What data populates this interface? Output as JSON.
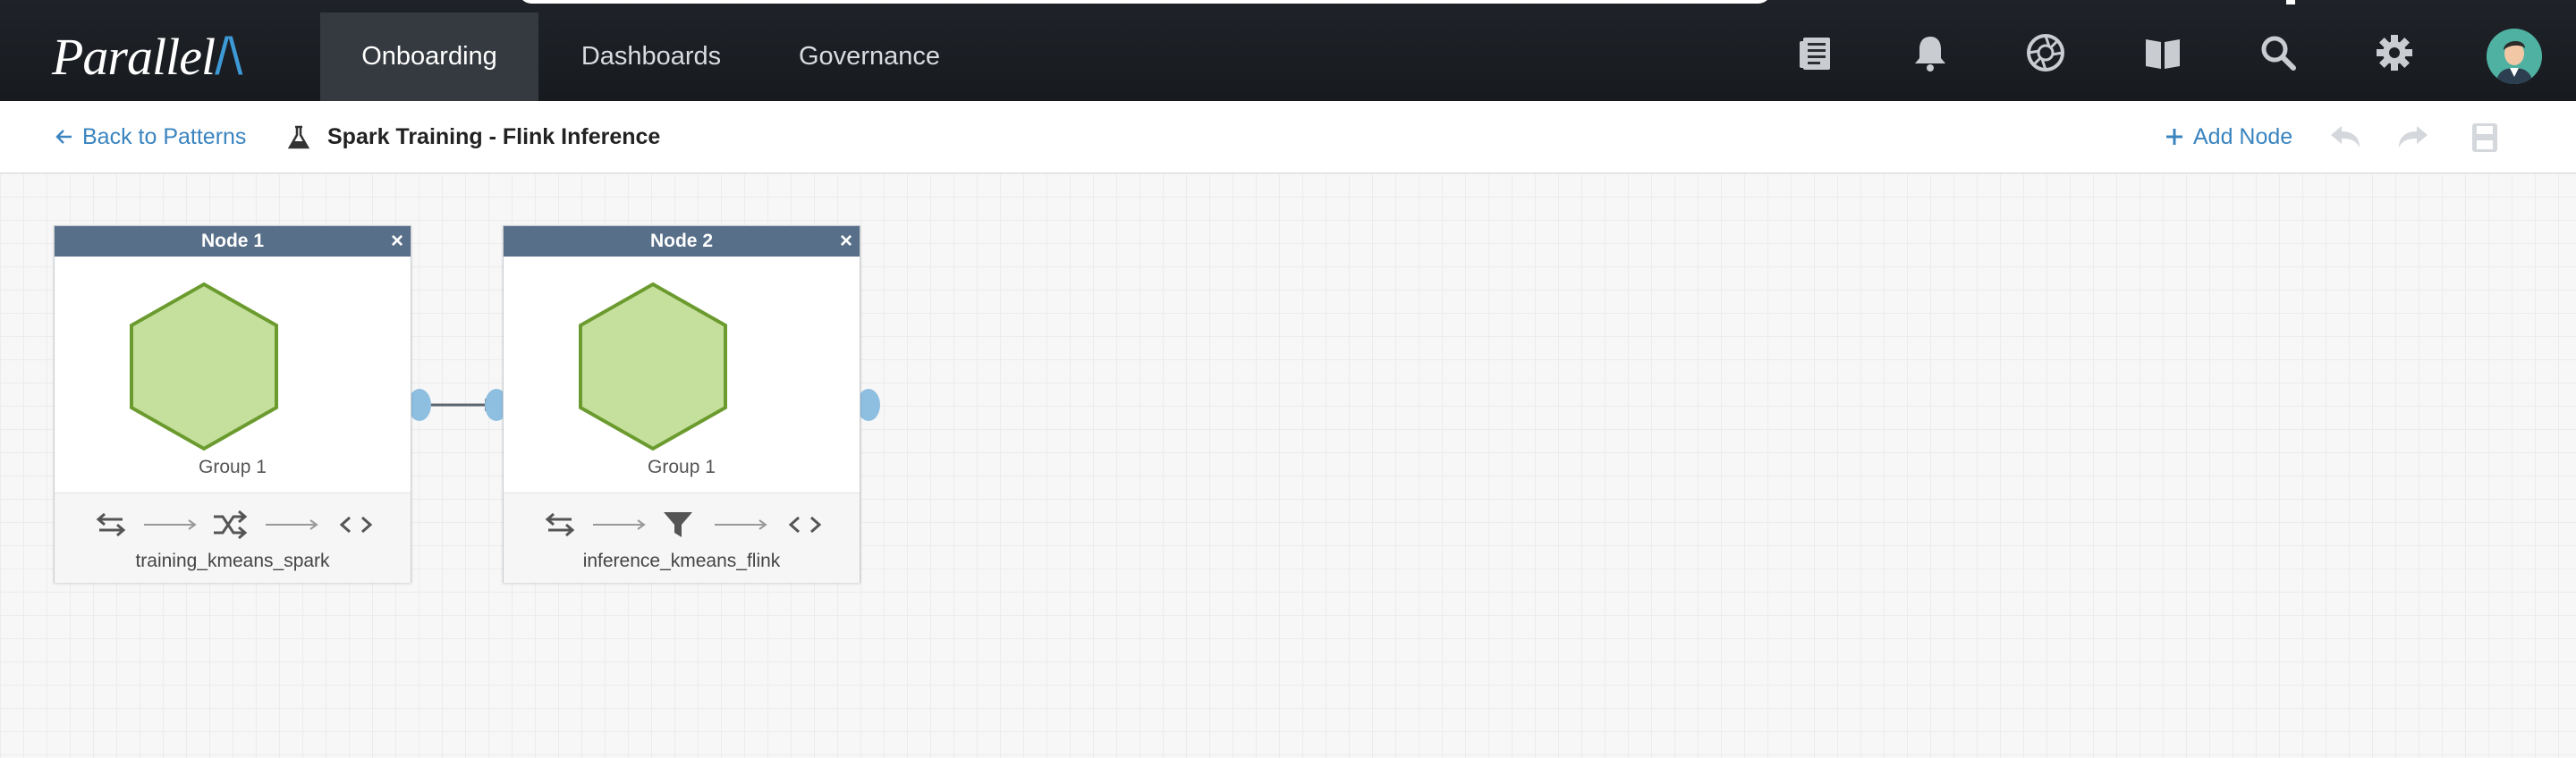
{
  "topbar": {
    "logo_text": "Parallel",
    "logo_mark": "/\\",
    "tabs": [
      {
        "label": "Onboarding",
        "active": true
      },
      {
        "label": "Dashboards",
        "active": false
      },
      {
        "label": "Governance",
        "active": false
      }
    ],
    "icons": [
      "document-icon",
      "bell-icon",
      "aperture-icon",
      "book-icon",
      "search-icon",
      "gear-icon",
      "avatar"
    ]
  },
  "subbar": {
    "back_label": "Back to Patterns",
    "title": "Spark Training - Flink Inference",
    "add_node_label": "Add Node",
    "icons": [
      "undo-icon",
      "redo-icon",
      "save-icon"
    ]
  },
  "nodes": [
    {
      "title": "Node 1",
      "close": "×",
      "group": "Group 1",
      "job": "training_kmeans_spark",
      "middle_icon": "shuffle-icon"
    },
    {
      "title": "Node 2",
      "close": "×",
      "group": "Group 1",
      "job": "inference_kmeans_flink",
      "middle_icon": "filter-icon"
    }
  ],
  "colors": {
    "accent": "#3a84bf",
    "node_header": "#586f89",
    "hex_fill": "#c5e09c",
    "hex_stroke": "#6b9b2e",
    "port": "#8fbfe0"
  }
}
